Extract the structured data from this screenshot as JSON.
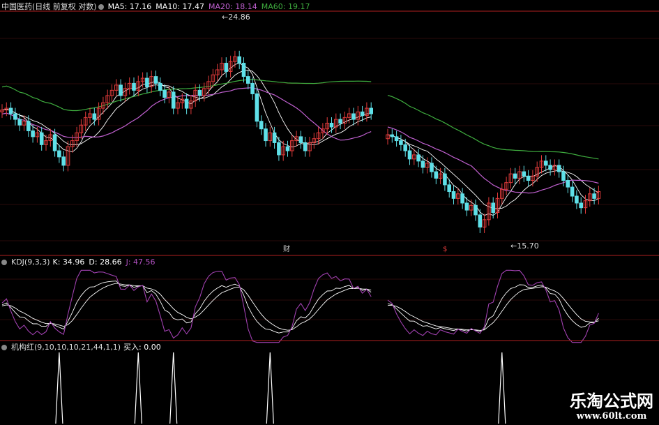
{
  "colors": {
    "bg": "#000000",
    "up": "#e23b3b",
    "down": "#5fe0e8",
    "ma5": "#ffffff",
    "ma10": "#ffffff",
    "ma20": "#c060d0",
    "ma60": "#3fae3f",
    "k": "#ffffff",
    "d": "#ffffff",
    "j": "#a040b0",
    "separator": "#b02020",
    "signal": "#ffffff"
  },
  "main_header": {
    "stock": "中国医药(日线 前复权 对数)",
    "ma5": "MA5: 17.16",
    "ma10": "MA10: 17.47",
    "ma20": "MA20: 18.14",
    "ma60": "MA60: 19.17"
  },
  "annotations": {
    "high": "24.86",
    "low": "15.70",
    "marker_cai": "财",
    "marker_s": "$"
  },
  "kdj_header": {
    "title": "KDJ(9,3,3)",
    "k": "K: 34.96",
    "d": "D: 28.66",
    "j": "J: 47.56"
  },
  "signal_header": {
    "title": "机构红(9,10,10,10,21,44,1,1)",
    "buy": "买入: 0.00"
  },
  "watermark": {
    "line1": "乐淘公式网",
    "line2": "www.60lt.com"
  },
  "chart_data": [
    {
      "type": "candlestick",
      "title": "中国医药(日线 前复权 对数)",
      "scale": "log",
      "annotations": [
        {
          "label": "24.86",
          "value": 24.86
        },
        {
          "label": "15.70",
          "value": 15.7
        }
      ],
      "legend": [
        "MA5: 17.16",
        "MA10: 17.47",
        "MA20: 18.14",
        "MA60: 19.17"
      ],
      "segments": [
        {
          "start_value": 21.4,
          "closes": [
            21.5,
            21.6,
            21.3,
            21.0,
            20.7,
            20.9,
            20.4,
            20.1,
            20.3,
            19.7,
            19.9,
            20.2,
            19.4,
            19.1,
            18.7,
            19.6,
            19.9,
            20.3,
            20.7,
            21.1,
            21.3,
            21.0,
            21.6,
            21.9,
            22.3,
            22.6,
            22.9,
            22.3,
            22.7,
            23.0,
            22.6,
            23.1,
            23.3,
            22.8,
            23.4,
            23.0,
            22.6,
            22.2,
            22.5,
            21.6,
            21.9,
            22.1,
            21.6,
            22.0,
            22.6,
            22.3,
            22.7,
            23.1,
            23.5,
            23.8,
            24.2,
            23.7,
            24.3,
            24.6,
            24.2,
            23.4,
            23.0,
            22.4,
            20.9,
            20.5,
            19.9,
            20.3,
            19.8,
            19.2,
            19.6,
            19.4,
            19.9,
            20.1,
            19.8,
            19.4,
            19.8,
            20.0,
            20.3,
            20.5,
            20.8,
            20.6,
            21.0,
            20.8,
            21.1,
            21.3,
            21.0,
            21.4,
            21.2,
            21.6,
            21.3
          ]
        },
        {
          "start_value": 20.0,
          "closes": [
            20.2,
            20.1,
            19.9,
            19.7,
            19.4,
            19.0,
            19.2,
            18.9,
            18.6,
            18.8,
            18.4,
            18.1,
            18.3,
            17.8,
            17.5,
            17.2,
            17.4,
            17.0,
            16.7,
            16.9,
            16.5,
            16.0,
            16.3,
            17.0,
            16.6,
            17.2,
            17.6,
            17.9,
            18.3,
            18.1,
            18.4,
            18.2,
            18.0,
            18.2,
            18.6,
            18.9,
            18.7,
            18.5,
            18.7,
            18.4,
            18.0,
            17.7,
            17.3,
            17.0,
            16.8,
            17.1,
            17.4,
            17.2,
            17.5
          ]
        }
      ]
    },
    {
      "type": "line",
      "title": "KDJ(9,3,3)",
      "series": [
        {
          "name": "K",
          "last": 34.96
        },
        {
          "name": "D",
          "last": 28.66
        },
        {
          "name": "J",
          "last": 47.56
        }
      ]
    },
    {
      "type": "line",
      "title": "机构红(9,10,10,10,21,44,1,1)",
      "series": [
        {
          "name": "买入",
          "last": 0.0
        }
      ],
      "spike_bar_indices": [
        13,
        31,
        39,
        61,
        111
      ]
    }
  ]
}
